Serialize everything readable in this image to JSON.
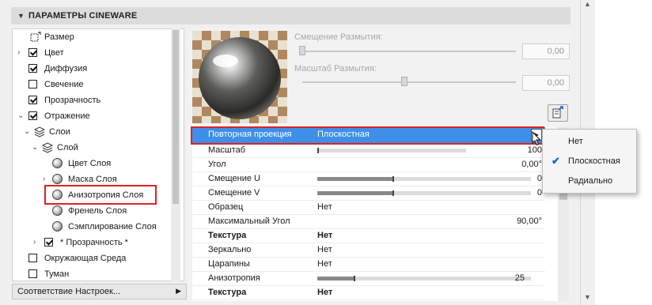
{
  "header": {
    "title": "ПАРАМЕТРЫ CINEWARE"
  },
  "tree": {
    "items": [
      {
        "label": "Размер"
      },
      {
        "label": "Цвет"
      },
      {
        "label": "Диффузия"
      },
      {
        "label": "Свечение"
      },
      {
        "label": "Прозрачность"
      },
      {
        "label": "Отражение"
      },
      {
        "label": "Слои"
      },
      {
        "label": "Слой"
      },
      {
        "label": "Цвет Слоя"
      },
      {
        "label": "Маска Слоя"
      },
      {
        "label": "Анизотропия Слоя"
      },
      {
        "label": "Френель Слоя"
      },
      {
        "label": "Сэмплирование Слоя"
      },
      {
        "label": "* Прозрачность *"
      },
      {
        "label": "Окружающая Среда"
      },
      {
        "label": "Туман"
      }
    ]
  },
  "bottom_selector": {
    "label": "Соответствие Настроек..."
  },
  "blur_offset": {
    "label": "Смещение Размытия:",
    "value": "0,00"
  },
  "blur_scale": {
    "label": "Масштаб Размытия:",
    "value": "0,00"
  },
  "grid": {
    "highlight": {
      "name": "Повторная проекция",
      "value": "Плоскостная"
    },
    "rows": [
      {
        "name": "Масштаб",
        "value": "100"
      },
      {
        "name": "Угол",
        "value": "0,00°"
      },
      {
        "name": "Смещение U",
        "value": "0"
      },
      {
        "name": "Смещение V",
        "value": "0"
      },
      {
        "name": "Образец",
        "value": "Нет"
      },
      {
        "name": "Максимальный Угол",
        "value": "90,00°"
      },
      {
        "name": "Текстура",
        "value": "Нет"
      },
      {
        "name": "Зеркально",
        "value": "Нет"
      },
      {
        "name": "Царапины",
        "value": "Нет"
      },
      {
        "name": "Анизотропия",
        "value": "25"
      },
      {
        "name": "Текстура",
        "value": "Нет"
      }
    ]
  },
  "dropdown": {
    "options": [
      "Нет",
      "Плоскостная",
      "Радиально"
    ],
    "selected": "Плоскостная"
  },
  "colors": {
    "selection": "#3e8fe8",
    "highlight_frame": "#e02020",
    "check": "#1a66d6"
  }
}
